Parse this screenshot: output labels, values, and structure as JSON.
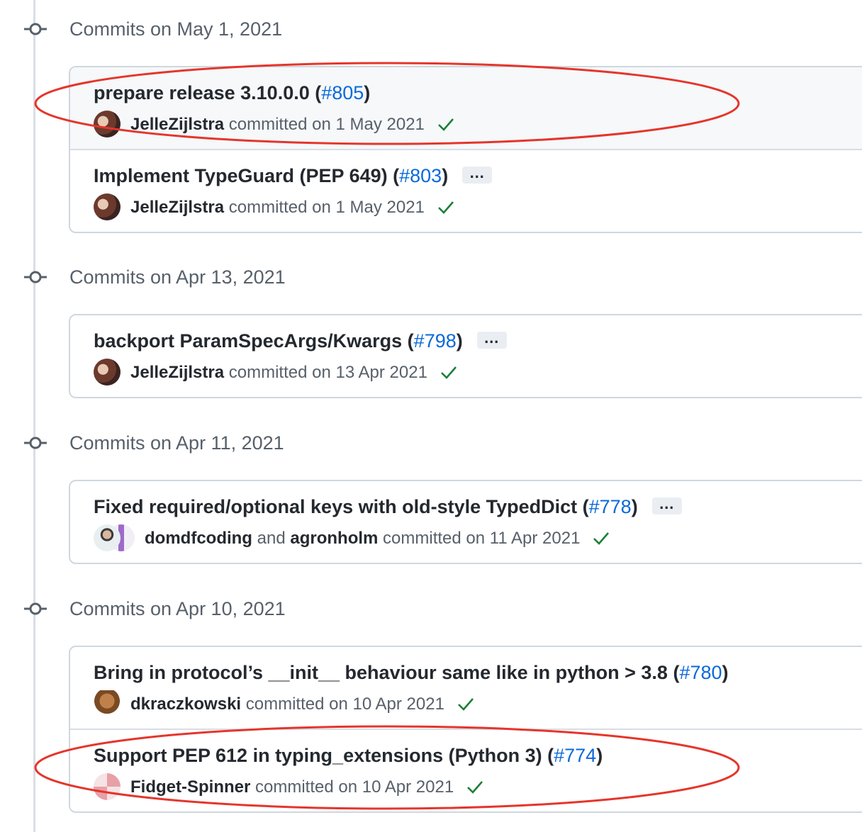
{
  "groups": [
    {
      "title": "Commits on May 1, 2021",
      "commits": [
        {
          "message": "prepare release 3.10.0.0 (",
          "pr": "#805",
          "close": ")",
          "author": "JelleZijlstra",
          "joiner": "",
          "author2": "",
          "committed": "committed on 1 May 2021"
        },
        {
          "message": "Implement TypeGuard (PEP 649) (",
          "pr": "#803",
          "close": ")",
          "ellipsis": "…",
          "author": "JelleZijlstra",
          "joiner": "",
          "author2": "",
          "committed": "committed on 1 May 2021"
        }
      ]
    },
    {
      "title": "Commits on Apr 13, 2021",
      "commits": [
        {
          "message": "backport ParamSpecArgs/Kwargs (",
          "pr": "#798",
          "close": ")",
          "ellipsis": "…",
          "author": "JelleZijlstra",
          "joiner": "",
          "author2": "",
          "committed": "committed on 13 Apr 2021"
        }
      ]
    },
    {
      "title": "Commits on Apr 11, 2021",
      "commits": [
        {
          "message": "Fixed required/optional keys with old-style TypedDict (",
          "pr": "#778",
          "close": ")",
          "ellipsis": "…",
          "author": "domdfcoding",
          "joiner": "and",
          "author2": "agronholm",
          "committed": "committed on 11 Apr 2021"
        }
      ]
    },
    {
      "title": "Commits on Apr 10, 2021",
      "commits": [
        {
          "message": "Bring in protocol’s __init__ behaviour same like in python > 3.8 (",
          "pr": "#780",
          "close": ")",
          "author": "dkraczkowski",
          "joiner": "",
          "author2": "",
          "committed": "committed on 10 Apr 2021"
        },
        {
          "message": "Support PEP 612 in typing_extensions (Python 3) (",
          "pr": "#774",
          "close": ")",
          "author": "Fidget-Spinner",
          "joiner": "",
          "author2": "",
          "committed": "committed on 10 Apr 2021"
        }
      ]
    }
  ],
  "colors": {
    "link": "#0969da",
    "check": "#1a7f37",
    "highlight": "#e5352b"
  }
}
